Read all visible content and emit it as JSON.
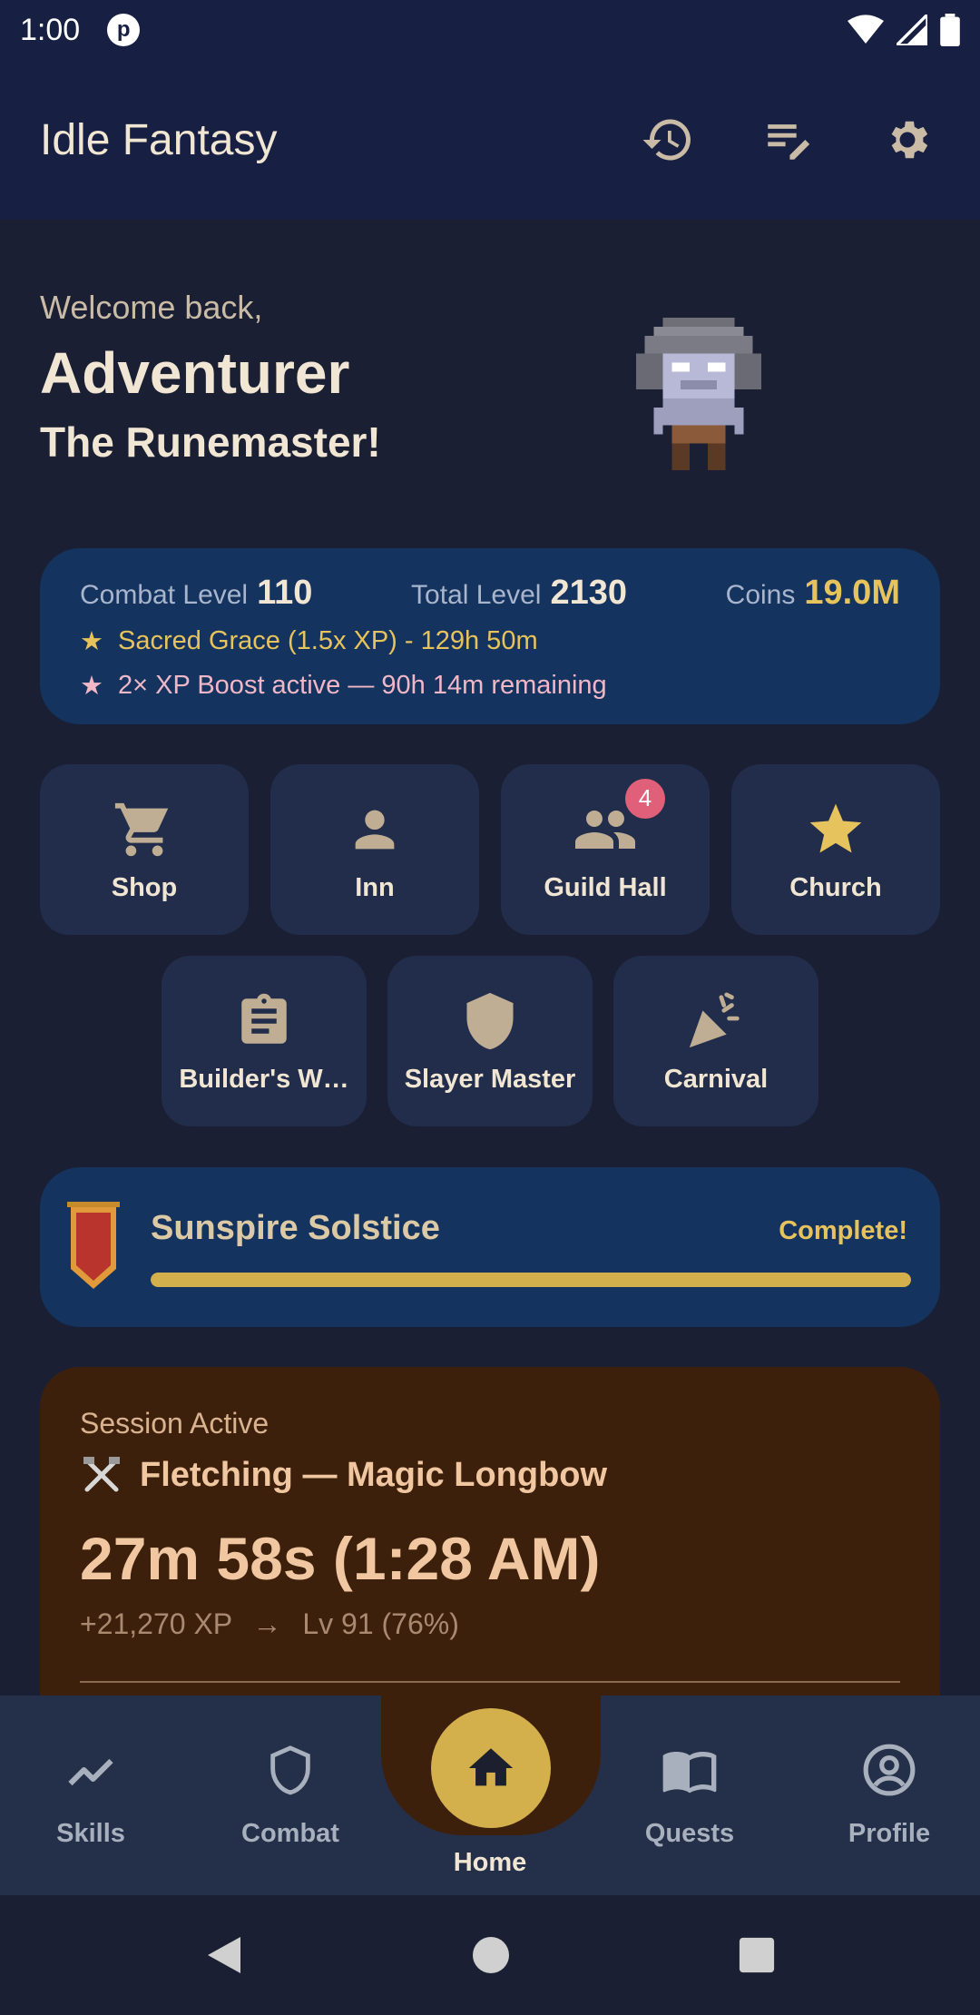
{
  "status_bar": {
    "time": "1:00",
    "app_icon": "p"
  },
  "app_bar": {
    "title": "Idle Fantasy",
    "icons": [
      "history-icon",
      "edit-list-icon",
      "gear-icon"
    ]
  },
  "welcome": {
    "greeting": "Welcome back,",
    "name": "Adventurer",
    "title": "The Runemaster!"
  },
  "stats": {
    "combat_label": "Combat Level",
    "combat_value": "110",
    "total_label": "Total Level",
    "total_value": "2130",
    "coins_label": "Coins",
    "coins_value": "19.0M",
    "buffs": [
      {
        "text": "Sacred Grace (1.5x XP) - 129h 50m",
        "color": "#e6c35c"
      },
      {
        "text": "2× XP Boost active — 90h 14m remaining",
        "color": "#f0b7c7"
      }
    ]
  },
  "tiles": [
    {
      "label": "Shop",
      "icon": "cart-icon"
    },
    {
      "label": "Inn",
      "icon": "person-icon"
    },
    {
      "label": "Guild Hall",
      "icon": "group-icon",
      "badge": "4"
    },
    {
      "label": "Church",
      "icon": "star-icon"
    },
    {
      "label": "Builder's W…",
      "icon": "clipboard-icon"
    },
    {
      "label": "Slayer Master",
      "icon": "shield-icon"
    },
    {
      "label": "Carnival",
      "icon": "party-icon"
    }
  ],
  "event": {
    "name": "Sunspire Solstice",
    "status": "Complete!",
    "progress": 1.0
  },
  "session": {
    "label": "Session Active",
    "task": "Fletching — Magic Longbow",
    "time": "27m 58s (1:28 AM)",
    "xp": "+21,270 XP",
    "arrow": "→",
    "level": "Lv 91 (76%)"
  },
  "bottom_nav": {
    "items": [
      {
        "label": "Skills",
        "icon": "trend-icon"
      },
      {
        "label": "Combat",
        "icon": "shield-outline-icon"
      },
      {
        "label": "Home",
        "icon": "home-icon",
        "active": true
      },
      {
        "label": "Quests",
        "icon": "book-icon"
      },
      {
        "label": "Profile",
        "icon": "account-circle-icon"
      }
    ]
  },
  "colors": {
    "accent": "#d4b04d",
    "background": "#1a1f33",
    "card": "#14335e",
    "session": "#3d200c"
  }
}
